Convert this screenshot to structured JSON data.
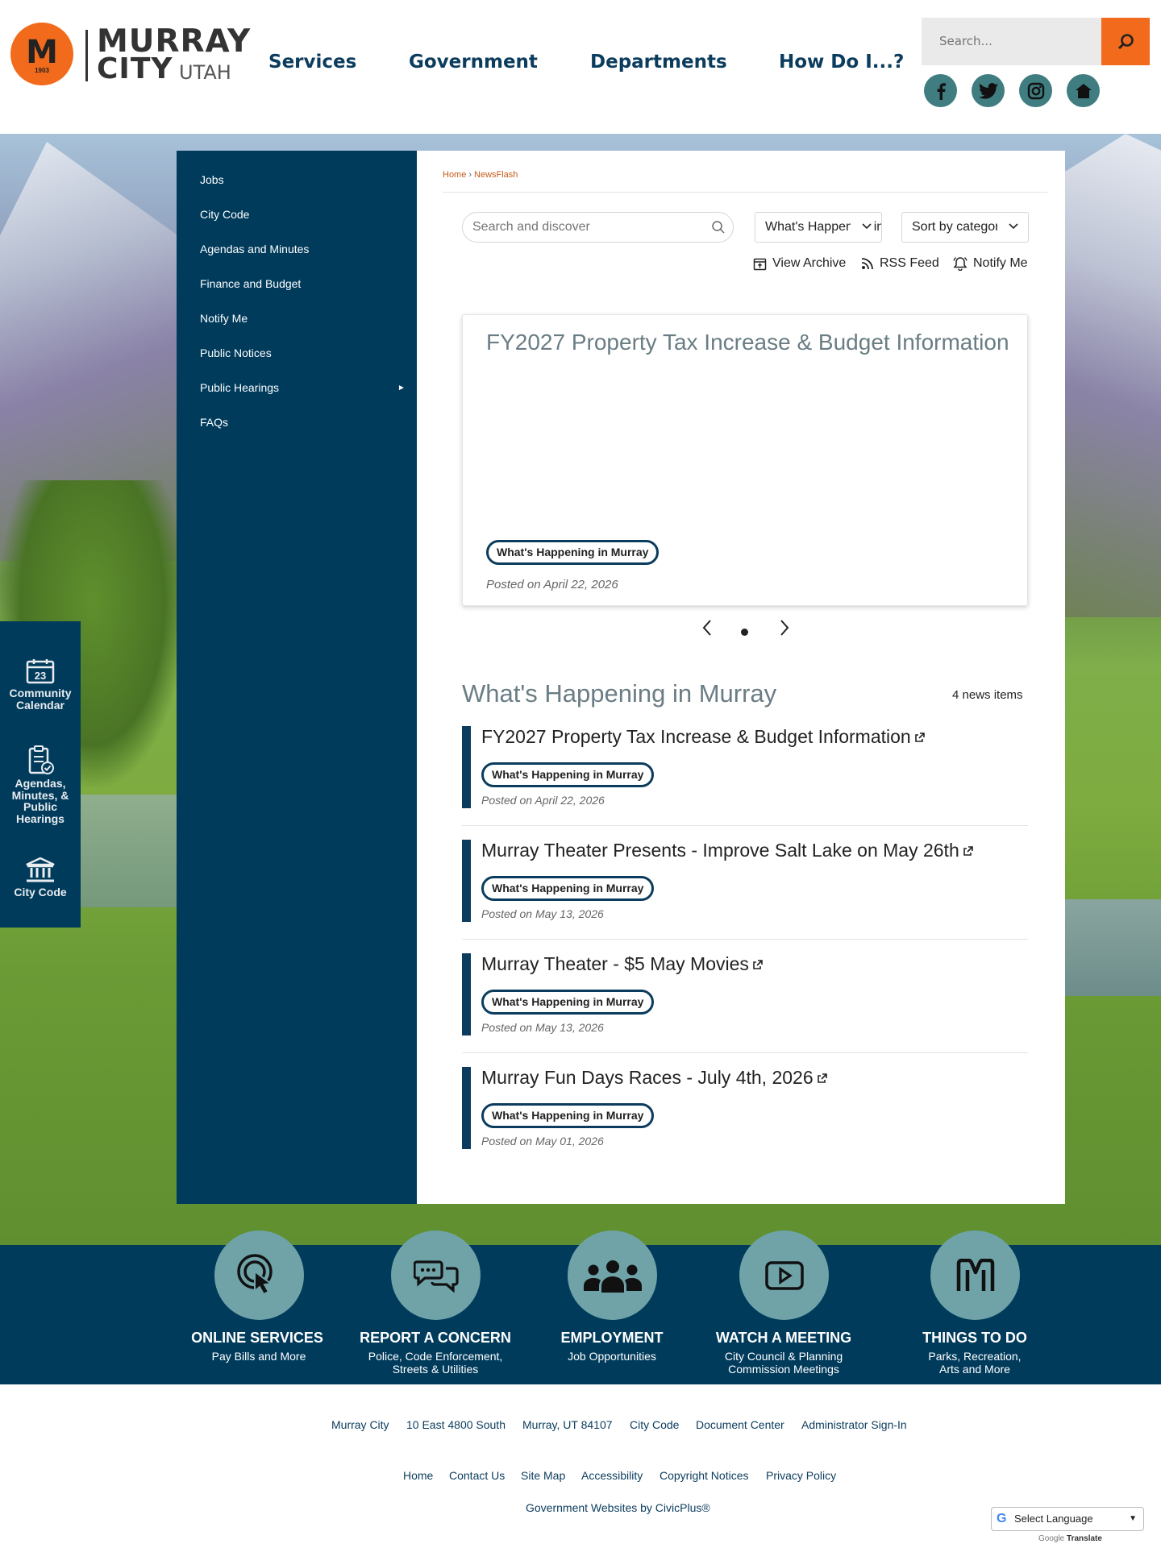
{
  "header": {
    "logo": {
      "line1": "MURRAY",
      "line2": "CITY",
      "line3": "UTAH",
      "year": "1903"
    },
    "nav": [
      "Services",
      "Government",
      "Departments",
      "How Do I...?"
    ],
    "search_placeholder": "Search...",
    "social": [
      "facebook-icon",
      "twitter-icon",
      "instagram-icon",
      "home-icon"
    ]
  },
  "quicklinks": [
    {
      "label": "Community Calendar",
      "icon": "calendar-icon",
      "day": "23"
    },
    {
      "label": "Agendas, Minutes, & Public Hearings",
      "icon": "clipboard-icon"
    },
    {
      "label": "City Code",
      "icon": "government-building-icon"
    }
  ],
  "sidebar": {
    "items": [
      {
        "label": "Jobs"
      },
      {
        "label": "City Code"
      },
      {
        "label": "Agendas and Minutes"
      },
      {
        "label": "Finance and Budget"
      },
      {
        "label": "Notify Me"
      },
      {
        "label": "Public Notices"
      },
      {
        "label": "Public Hearings",
        "arrow": "►"
      },
      {
        "label": "FAQs"
      }
    ]
  },
  "breadcrumb": {
    "home": "Home",
    "sep": "›",
    "current": "NewsFlash"
  },
  "filters": {
    "search_placeholder": "Search and discover",
    "category": "What's Happening in Murray",
    "sort": "Sort by category"
  },
  "actions": {
    "archive": "View Archive",
    "rss": "RSS Feed",
    "notify": "Notify Me"
  },
  "featured": {
    "title": "FY2027 Property Tax Increase & Budget Information",
    "tag": "What's Happening in Murray",
    "posted": "Posted on April 22, 2026"
  },
  "section": {
    "title": "What's Happening in Murray",
    "count": "4 news items"
  },
  "news": [
    {
      "title": "FY2027 Property Tax Increase & Budget Information",
      "tag": "What's Happening in Murray",
      "posted": "Posted on April 22, 2026"
    },
    {
      "title": "Murray Theater Presents - Improve Salt Lake on May 26th",
      "tag": "What's Happening in Murray",
      "posted": "Posted on May 13, 2026"
    },
    {
      "title": "Murray Theater - $5 May Movies",
      "tag": "What's Happening in Murray",
      "posted": "Posted on May 13, 2026"
    },
    {
      "title": "Murray Fun Days Races - July 4th, 2026",
      "tag": "What's Happening in Murray",
      "posted": "Posted on May 01, 2026"
    }
  ],
  "strip": [
    {
      "title": "ONLINE SERVICES",
      "sub1": "Pay Bills and More",
      "sub2": "",
      "icon": "touch-icon"
    },
    {
      "title": "REPORT A CONCERN",
      "sub1": "Police, Code Enforcement,",
      "sub2": "Streets & Utilities",
      "icon": "chat-icon"
    },
    {
      "title": "EMPLOYMENT",
      "sub1": "Job Opportunities",
      "sub2": "",
      "icon": "people-icon"
    },
    {
      "title": "WATCH A MEETING",
      "sub1": "City Council & Planning",
      "sub2": "Commission Meetings",
      "icon": "play-icon"
    },
    {
      "title": "THINGS TO DO",
      "sub1": "Parks, Recreation,",
      "sub2": "Arts and More",
      "icon": "murray-m-icon"
    }
  ],
  "footer": {
    "row1": [
      "Murray City",
      "10 East 4800 South",
      "Murray, UT 84107",
      "City Code",
      "Document Center",
      "Administrator Sign-In"
    ],
    "row2": [
      "Home",
      "Contact Us",
      "Site Map",
      "Accessibility",
      "Copyright Notices",
      "Privacy Policy"
    ],
    "credit": "Government Websites by CivicPlus®"
  },
  "translate": {
    "label": "Select Language",
    "g": "G",
    "by": "Google",
    "brand": "Translate"
  },
  "colors": {
    "navy": "#003b5c",
    "orange": "#f26a1b",
    "teal": "#6fa3a8",
    "link_orange": "#c85a17"
  }
}
